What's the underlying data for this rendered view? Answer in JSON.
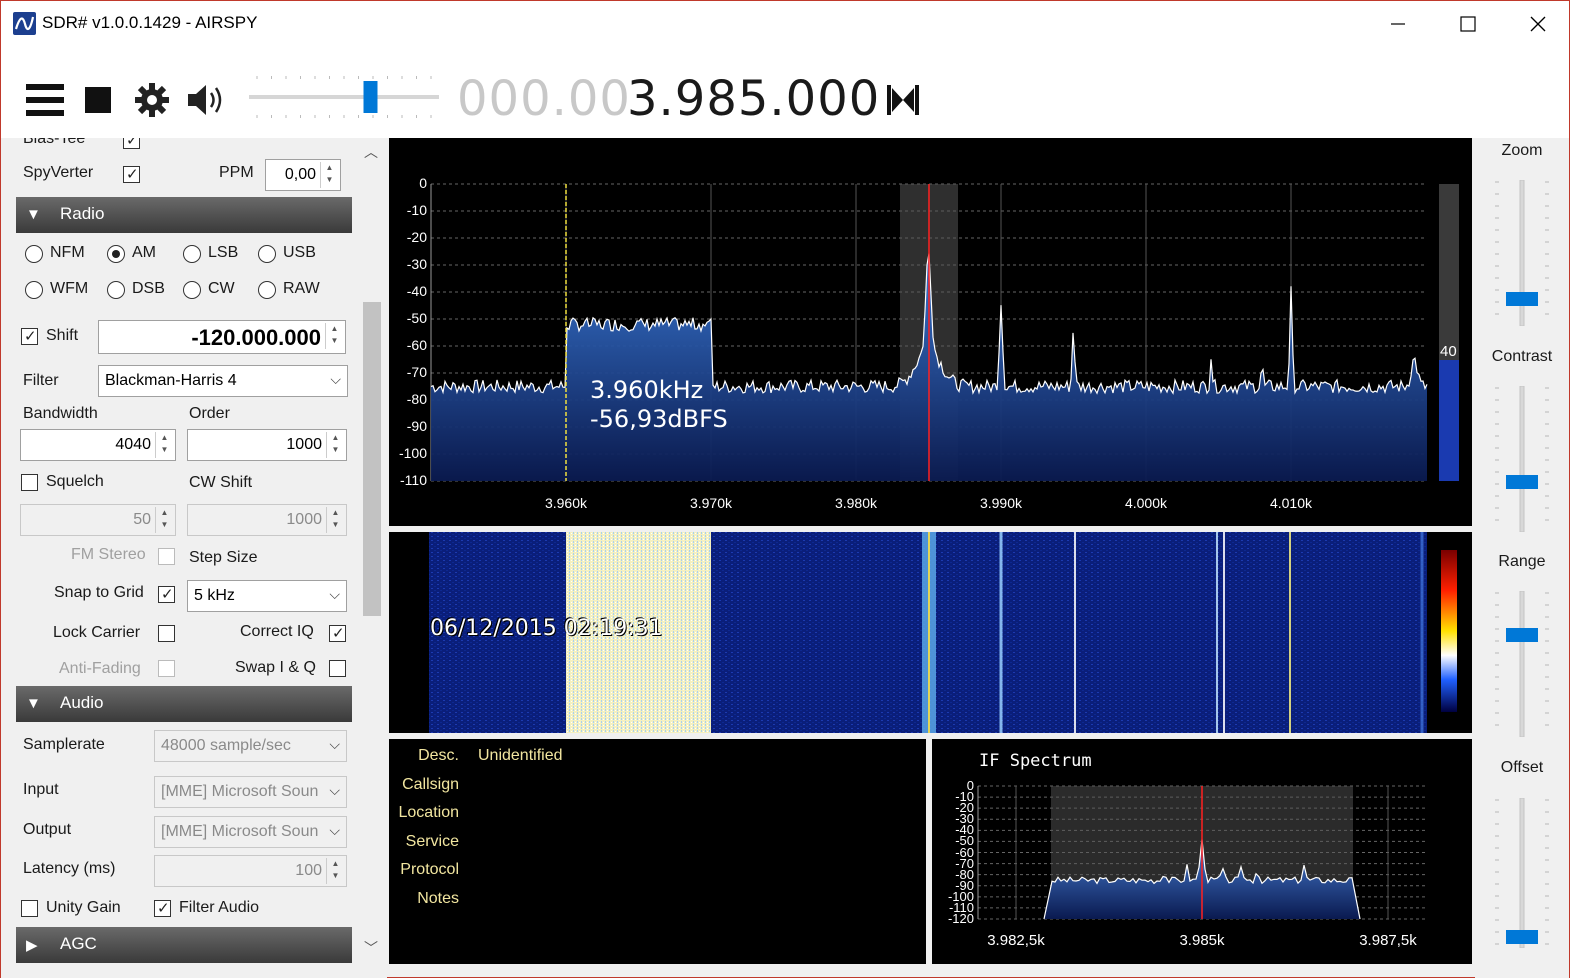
{
  "window": {
    "title": "SDR# v1.0.0.1429 - AIRSPY"
  },
  "toolbar": {
    "freq_dim": "000.00",
    "freq_main": "3.985.000",
    "volume_level": 0.65
  },
  "left": {
    "bias_tee": "Bias-Tee",
    "spyverter": "SpyVerter",
    "ppm_label": "PPM",
    "ppm_value": "0,00",
    "radio_header": "Radio",
    "modes": [
      "NFM",
      "AM",
      "LSB",
      "USB",
      "WFM",
      "DSB",
      "CW",
      "RAW"
    ],
    "selected_mode": "AM",
    "shift_label": "Shift",
    "shift_value": "-120.000.000",
    "filter_label": "Filter",
    "filter_value": "Blackman-Harris 4",
    "bandwidth_label": "Bandwidth",
    "bandwidth_value": "4040",
    "order_label": "Order",
    "order_value": "1000",
    "squelch_label": "Squelch",
    "squelch_value": "50",
    "cwshift_label": "CW Shift",
    "cwshift_value": "1000",
    "fmstereo_label": "FM Stereo",
    "stepsize_label": "Step Size",
    "snap_label": "Snap to Grid",
    "step_value": "5 kHz",
    "lockcarrier_label": "Lock Carrier",
    "correctiq_label": "Correct IQ",
    "antifading_label": "Anti-Fading",
    "swapiq_label": "Swap I & Q",
    "audio_header": "Audio",
    "samplerate_label": "Samplerate",
    "samplerate_value": "48000 sample/sec",
    "input_label": "Input",
    "input_value": "[MME] Microsoft Soun",
    "output_label": "Output",
    "output_value": "[MME] Microsoft Soun",
    "latency_label": "Latency (ms)",
    "latency_value": "100",
    "unitygain_label": "Unity Gain",
    "filteraudio_label": "Filter Audio",
    "agc_header": "AGC"
  },
  "spectrum": {
    "db_ticks": [
      "0",
      "-10",
      "-20",
      "-30",
      "-40",
      "-50",
      "-60",
      "-70",
      "-80",
      "-90",
      "-100",
      "-110"
    ],
    "freq_ticks": [
      "3.960k",
      "3.970k",
      "3.980k",
      "3.990k",
      "4.000k",
      "4.010k"
    ],
    "cursor_freq": "3.960kHz",
    "cursor_level": "-56,93dBFS",
    "scale_value": "40"
  },
  "waterfall": {
    "timestamp": "06/12/2015 02:19:31"
  },
  "info": {
    "labels": [
      "Desc.",
      "Callsign",
      "Location",
      "Service",
      "Protocol",
      "Notes"
    ],
    "desc_value": "Unidentified"
  },
  "if_spectrum": {
    "title": "IF Spectrum",
    "db_ticks": [
      "0",
      "-10",
      "-20",
      "-30",
      "-40",
      "-50",
      "-60",
      "-70",
      "-80",
      "-90",
      "-100",
      "-110",
      "-120"
    ],
    "freq_ticks": [
      "3.982,5k",
      "3.985k",
      "3.987,5k"
    ]
  },
  "right": {
    "zoom_label": "Zoom",
    "contrast_label": "Contrast",
    "range_label": "Range",
    "offset_label": "Offset"
  },
  "colors": {
    "accent": "#0078d7",
    "spectrum_fill": "#1e50a8",
    "tuning_line": "#ff2020",
    "marker": "#f0e040"
  }
}
